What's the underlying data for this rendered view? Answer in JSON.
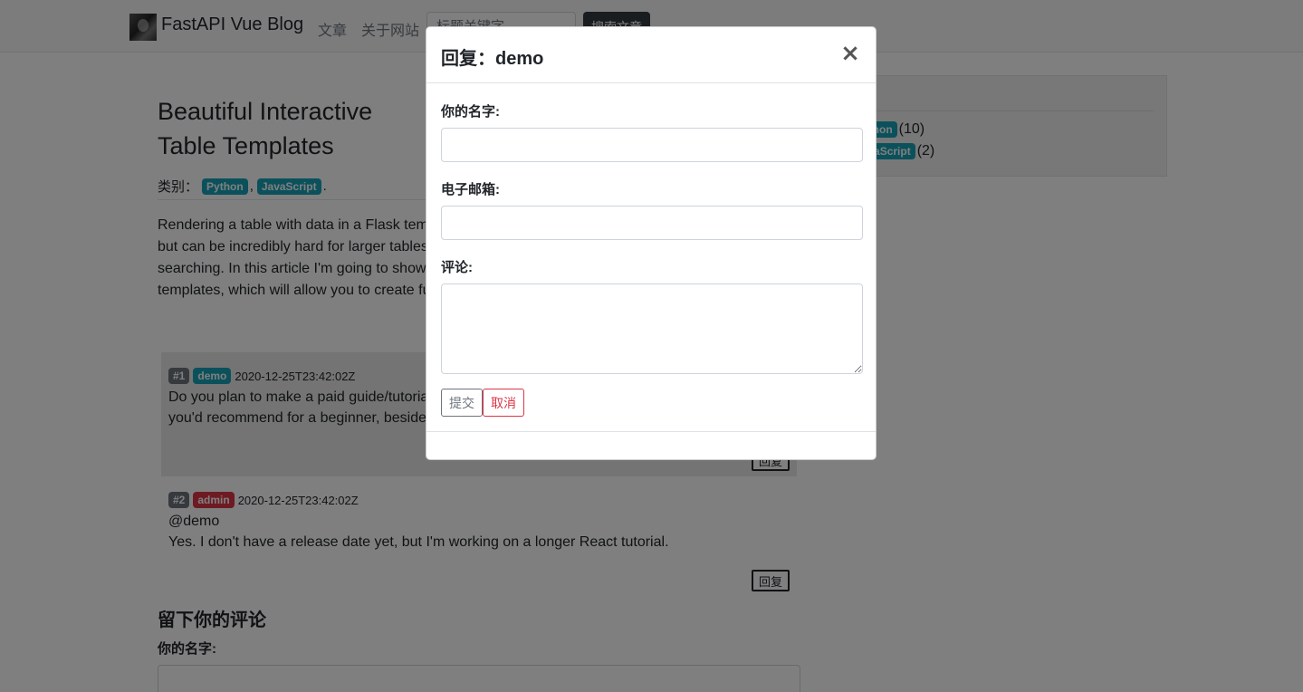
{
  "navbar": {
    "brand": "FastAPI Vue Blog",
    "links": [
      {
        "label": "文章"
      },
      {
        "label": "关于网站"
      }
    ],
    "search_placeholder": "标题关键字",
    "search_button": "搜索文章"
  },
  "post": {
    "title": "Beautiful Interactive Table Templates",
    "category_prefix": "类别：",
    "categories": [
      "Python",
      "JavaScript"
    ],
    "category_sep": ",",
    "category_end": ".",
    "body": "Rendering a table with data in a Flask template is a relatively simple task when the table is short, but can be incredibly hard for larger tables that require features such as sorting, pagination and searching. In this article I'm going to show you how to integrate the dataTables.js library in your templates, which will allow you to create fully featured tables with ease!"
  },
  "sidebar": {
    "categories": [
      {
        "name": "Python",
        "count": "(10)"
      },
      {
        "name": "JavaScript",
        "count": "(2)"
      }
    ]
  },
  "comments": [
    {
      "index": "#1",
      "author": "demo",
      "time": "2020-12-25T23:42:02Z",
      "lines": [
        "Do you plan to make a paid guide/tutorial? Do you have any resources",
        "you'd recommend for a beginner, besides the ones mentioned here?"
      ],
      "reply_label": "回复"
    },
    {
      "index": "#2",
      "author": "admin",
      "time": "2020-12-25T23:42:02Z",
      "lines": [
        "@demo",
        "Yes. I don't have a release date yet, but I'm working on a longer React tutorial."
      ],
      "reply_label": "回复"
    }
  ],
  "leave_comment": {
    "heading": "留下你的评论",
    "name_label": "你的名字:"
  },
  "modal": {
    "title": "回复：demo",
    "close": "×",
    "name_label": "你的名字:",
    "name_value": "",
    "email_label": "电子邮箱:",
    "email_value": "",
    "comment_label": "评论:",
    "comment_value": "",
    "submit_label": "提交",
    "cancel_label": "取消"
  },
  "colors": {
    "info": "#17a2b8",
    "danger": "#dc3545",
    "secondary": "#6c757d",
    "backdrop": "rgba(0,0,0,0.5)"
  }
}
